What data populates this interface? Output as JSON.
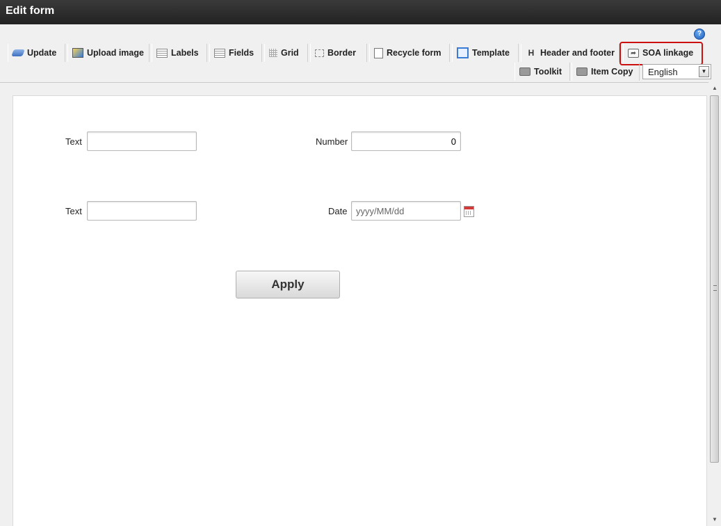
{
  "window": {
    "title": "Edit form"
  },
  "toolbar": {
    "row1": [
      {
        "label": "Update",
        "icon": "update-icon"
      },
      {
        "label": "Upload image",
        "icon": "image-icon"
      },
      {
        "label": "Labels",
        "icon": "labels-icon"
      },
      {
        "label": "Fields",
        "icon": "fields-icon"
      },
      {
        "label": "Grid",
        "icon": "grid-icon"
      },
      {
        "label": "Border",
        "icon": "border-icon"
      },
      {
        "label": "Recycle form",
        "icon": "document-icon"
      },
      {
        "label": "Template",
        "icon": "template-icon"
      },
      {
        "label": "Header and footer",
        "icon": "header-icon"
      },
      {
        "label": "SOA linkage",
        "icon": "share-icon"
      }
    ],
    "row2": [
      {
        "label": "Toolkit",
        "icon": "toolbox-icon"
      },
      {
        "label": "Item Copy",
        "icon": "toolbox-icon"
      }
    ],
    "language": {
      "selected": "English"
    },
    "highlight_color": "#cc1010"
  },
  "form": {
    "text1": {
      "label": "Text",
      "value": ""
    },
    "number": {
      "label": "Number",
      "value": "0"
    },
    "text2": {
      "label": "Text",
      "value": ""
    },
    "date": {
      "label": "Date",
      "placeholder": "yyyy/MM/dd"
    },
    "apply_label": "Apply"
  }
}
